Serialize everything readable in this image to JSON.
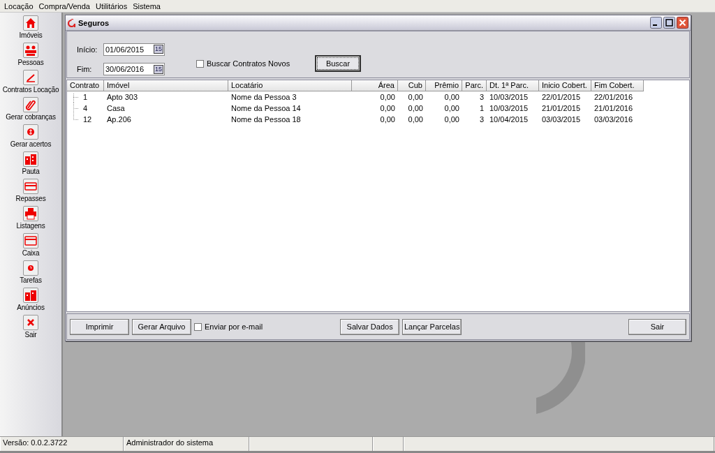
{
  "menu": [
    "Locação",
    "Compra/Venda",
    "Utilitários",
    "Sistema"
  ],
  "sidebar": {
    "items": [
      {
        "label": "Imóveis"
      },
      {
        "label": "Pessoas"
      },
      {
        "label": "Contratos Locação"
      },
      {
        "label": "Gerar cobranças"
      },
      {
        "label": "Gerar acertos"
      },
      {
        "label": "Pauta"
      },
      {
        "label": "Repasses"
      },
      {
        "label": "Listagens"
      },
      {
        "label": "Caixa"
      },
      {
        "label": "Tarefas"
      },
      {
        "label": "Anúncios"
      },
      {
        "label": "Sair"
      }
    ]
  },
  "window": {
    "title": "Seguros"
  },
  "filters": {
    "start": {
      "label": "Início:",
      "value": "01/06/2015",
      "calendar_label": "15"
    },
    "end": {
      "label": "Fim:",
      "value": "30/06/2016",
      "calendar_label": "15"
    },
    "new_contracts": {
      "label": "Buscar Contratos Novos",
      "checked": false
    },
    "search_button": "Buscar"
  },
  "table": {
    "columns": [
      "Contrato",
      "Imóvel",
      "Locatário",
      "Área",
      "Cub",
      "Prêmio",
      "Parc.",
      "Dt. 1ª Parc.",
      "Inicio Cobert.",
      "Fim Cobert."
    ],
    "rows": [
      [
        "1",
        "Apto 303",
        "Nome da Pessoa 3",
        "0,00",
        "0,00",
        "0,00",
        "3",
        "10/03/2015",
        "22/01/2015",
        "22/01/2016"
      ],
      [
        "4",
        "Casa",
        "Nome da Pessoa 14",
        "0,00",
        "0,00",
        "0,00",
        "1",
        "10/03/2015",
        "21/01/2015",
        "21/01/2016"
      ],
      [
        "12",
        "Ap.206",
        "Nome da Pessoa 18",
        "0,00",
        "0,00",
        "0,00",
        "3",
        "10/04/2015",
        "03/03/2015",
        "03/03/2016"
      ]
    ]
  },
  "footer": {
    "print_button": "Imprimir",
    "file_button": "Gerar Arquivo",
    "email": {
      "label": "Enviar por e-mail",
      "checked": false
    },
    "save_button": "Salvar Dados",
    "installments_button": "Lançar Parcelas",
    "exit_button": "Sair"
  },
  "status_bar": [
    "Versão: 0.0.2.3722",
    "Administrador do sistema"
  ]
}
